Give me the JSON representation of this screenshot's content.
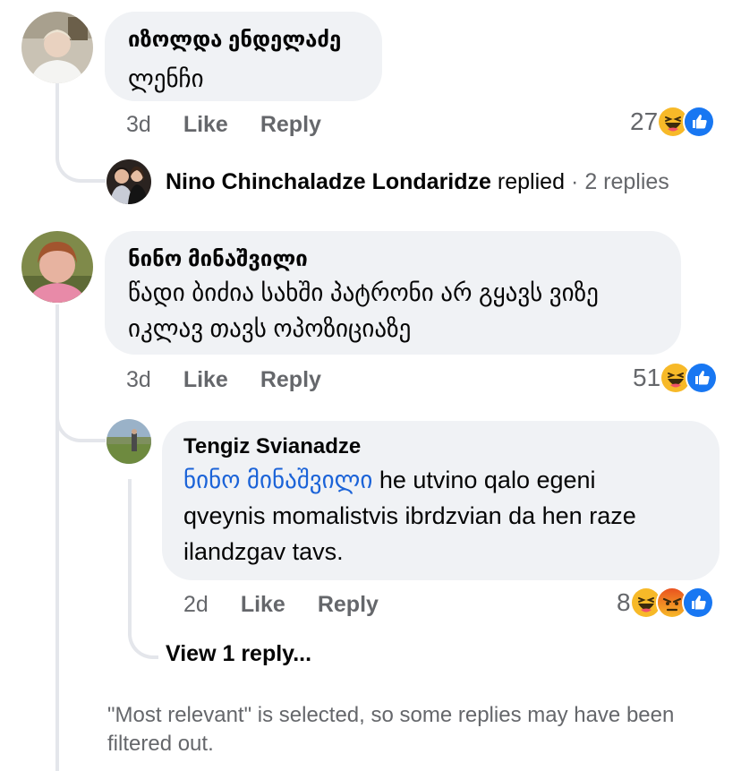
{
  "comments": [
    {
      "author": "იზოლდა ენდელაძე",
      "text_lines": [
        "ლენჩი"
      ],
      "time": "3d",
      "like_label": "Like",
      "reply_label": "Reply",
      "reaction_count": "27",
      "reactions": [
        "haha",
        "like"
      ]
    },
    {
      "author": "ნინო მინაშვილი",
      "text_lines": [
        "წადი ბიძია სახში პატრონი არ გყავს ვიზე",
        "იკლავ თავს ოპოზიციაზე"
      ],
      "time": "3d",
      "like_label": "Like",
      "reply_label": "Reply",
      "reaction_count": "51",
      "reactions": [
        "haha",
        "like"
      ]
    }
  ],
  "replied_summary": {
    "name": "Nino Chinchaladze Londaridze",
    "verb": "replied",
    "separator": "·",
    "count": "2 replies"
  },
  "reply": {
    "author": "Tengiz Svianadze",
    "mention": "ნინო მინაშვილი",
    "line1_rest": " he utvino qalo egeni",
    "line2": "qveynis momalistvis ibrdzvian da hen raze",
    "line3": "ilandzgav tavs.",
    "time": "2d",
    "like_label": "Like",
    "reply_label": "Reply",
    "reaction_count": "8",
    "reactions": [
      "haha",
      "angry",
      "like"
    ]
  },
  "view_more": "View 1 reply...",
  "filter_notice": "\"Most relevant\" is selected, so some replies may have been filtered out.",
  "colors": {
    "bubble": "#f0f2f5",
    "thread_line": "#e4e6eb",
    "meta": "#65676b",
    "mention": "#1b63d8",
    "like_blue": "#1877f2",
    "haha_yellow": "#f7b928",
    "angry_orange": "#e9710f"
  }
}
